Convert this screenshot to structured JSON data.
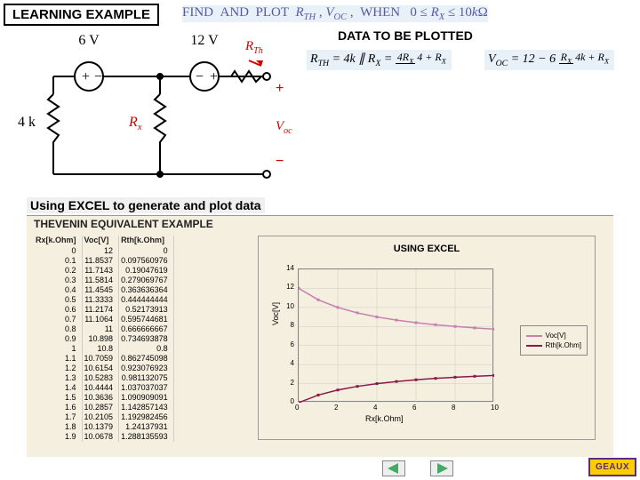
{
  "title": "LEARNING EXAMPLE",
  "find_text": "FIND AND PLOT R_TH , V_OC ,  WHEN  0 ≤ R_X ≤ 10kΩ",
  "data_title": "DATA TO BE PLOTTED",
  "formula_rth": "R_TH = 4k ∥ R_X = 4R_X / (4 + R_X)",
  "formula_voc": "V_OC = 12 − 6 · R_X / (4k + R_X)",
  "circuit": {
    "v1": "6 V",
    "v2": "12 V",
    "r_fixed": "4 k",
    "r_var": "R_x",
    "rth": "R_Th",
    "voc": "V_oc",
    "plus": "+",
    "minus": "−"
  },
  "using_excel": "Using EXCEL to generate and plot data",
  "excel_title_row": "THEVENIN EQUIVALENT EXAMPLE",
  "table": {
    "headers": [
      "Rx[k.Ohm]",
      "Voc[V]",
      "Rth[k.Ohm]"
    ],
    "rows": [
      [
        "0",
        "12",
        "0"
      ],
      [
        "0.1",
        "11.8537",
        "0.097560976"
      ],
      [
        "0.2",
        "11.7143",
        "0.19047619"
      ],
      [
        "0.3",
        "11.5814",
        "0.279069767"
      ],
      [
        "0.4",
        "11.4545",
        "0.363636364"
      ],
      [
        "0.5",
        "11.3333",
        "0.444444444"
      ],
      [
        "0.6",
        "11.2174",
        "0.52173913"
      ],
      [
        "0.7",
        "11.1064",
        "0.595744681"
      ],
      [
        "0.8",
        "11",
        "0.666666667"
      ],
      [
        "0.9",
        "10.898",
        "0.734693878"
      ],
      [
        "1",
        "10.8",
        "0.8"
      ],
      [
        "1.1",
        "10.7059",
        "0.862745098"
      ],
      [
        "1.2",
        "10.6154",
        "0.923076923"
      ],
      [
        "1.3",
        "10.5283",
        "0.981132075"
      ],
      [
        "1.4",
        "10.4444",
        "1.037037037"
      ],
      [
        "1.5",
        "10.3636",
        "1.090909091"
      ],
      [
        "1.6",
        "10.2857",
        "1.142857143"
      ],
      [
        "1.7",
        "10.2105",
        "1.192982456"
      ],
      [
        "1.8",
        "10.1379",
        "1.24137931"
      ],
      [
        "1.9",
        "10.0678",
        "1.288135593"
      ]
    ]
  },
  "chart_data": {
    "type": "line",
    "title": "USING EXCEL",
    "xlabel": "Rx[k.Ohm]",
    "ylabel": "Voc[V]",
    "xlim": [
      0,
      10
    ],
    "ylim": [
      0,
      14
    ],
    "xticks": [
      0,
      2,
      4,
      6,
      8,
      10
    ],
    "yticks": [
      0,
      2,
      4,
      6,
      8,
      10,
      12,
      14
    ],
    "x": [
      0,
      1,
      2,
      3,
      4,
      5,
      6,
      7,
      8,
      9,
      10
    ],
    "series": [
      {
        "name": "Voc[V]",
        "color": "#c97fb0",
        "values": [
          12,
          10.8,
          10.0,
          9.43,
          9.0,
          8.67,
          8.4,
          8.18,
          8.0,
          7.85,
          7.71
        ]
      },
      {
        "name": "Rth[k.Ohm]",
        "color": "#8a1a4a",
        "values": [
          0,
          0.8,
          1.33,
          1.71,
          2.0,
          2.22,
          2.4,
          2.55,
          2.67,
          2.77,
          2.86
        ]
      }
    ]
  },
  "nav": {
    "prev": "◀",
    "next": "▶"
  },
  "geaux": "GEAUX"
}
